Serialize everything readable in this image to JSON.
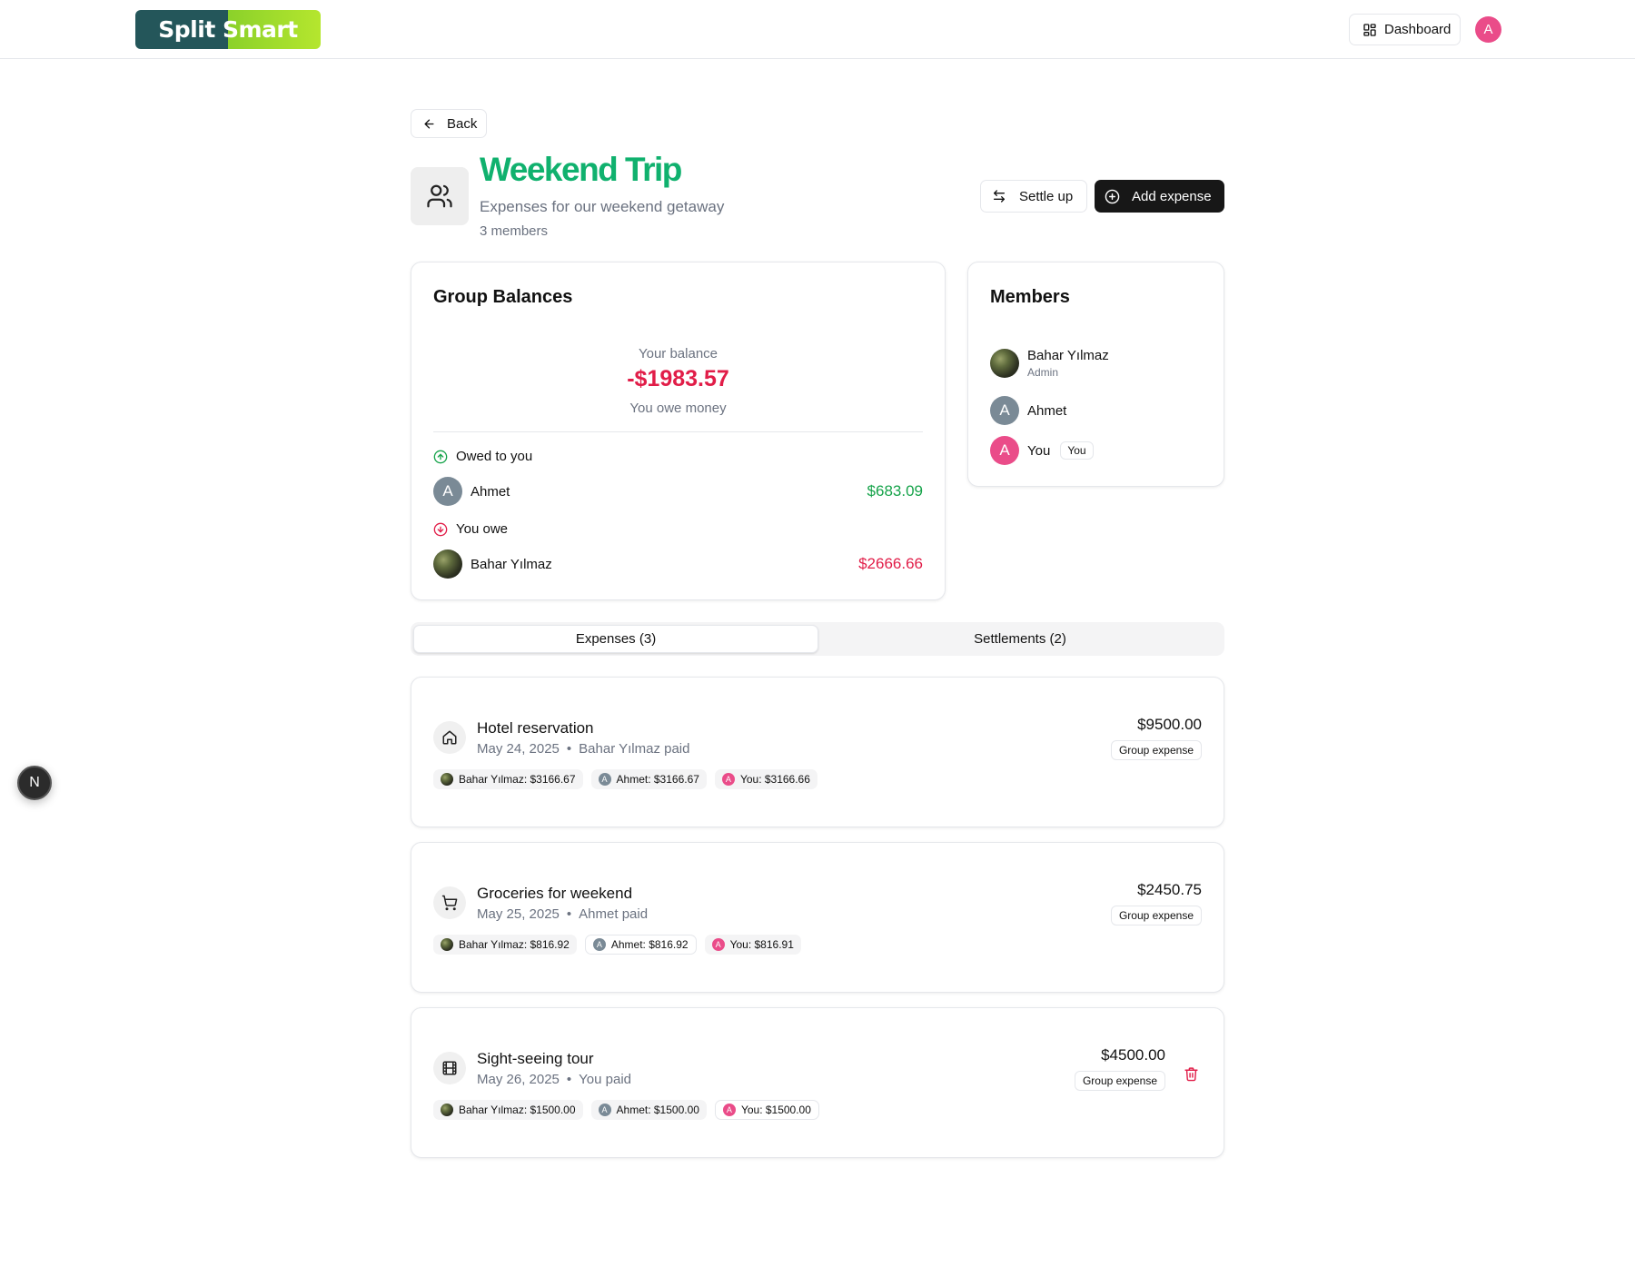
{
  "header": {
    "logo_part1": "Split",
    "logo_part2": "Smart",
    "dashboard_label": "Dashboard",
    "avatar_initial": "A"
  },
  "nav": {
    "back_label": "Back"
  },
  "group": {
    "title": "Weekend Trip",
    "description": "Expenses for our weekend getaway",
    "members_count": "3 members",
    "settle_label": "Settle up",
    "add_expense_label": "Add expense"
  },
  "balances": {
    "title": "Group Balances",
    "your_balance_label": "Your balance",
    "your_balance_value": "-$1983.57",
    "your_balance_note": "You owe money",
    "owed_to_you_label": "Owed to you",
    "owed_to_you": [
      {
        "name": "Ahmet",
        "initial": "A",
        "amount": "$683.09"
      }
    ],
    "you_owe_label": "You owe",
    "you_owe": [
      {
        "name": "Bahar Yılmaz",
        "amount": "$2666.66"
      }
    ]
  },
  "members": {
    "title": "Members",
    "list": [
      {
        "name": "Bahar Yılmaz",
        "role": "Admin"
      },
      {
        "name": "Ahmet",
        "initial": "A"
      },
      {
        "name": "You",
        "initial": "A",
        "tag": "You"
      }
    ]
  },
  "tabs": [
    {
      "label": "Expenses (3)",
      "active": true
    },
    {
      "label": "Settlements (2)",
      "active": false
    }
  ],
  "expenses": [
    {
      "icon": "home-icon",
      "title": "Hotel reservation",
      "date": "May 24, 2025",
      "paid_by": "Bahar Yılmaz paid",
      "amount": "$9500.00",
      "badge": "Group expense",
      "splits": [
        {
          "label": "Bahar Yılmaz: $3166.67"
        },
        {
          "label": "Ahmet: $3166.67",
          "initial": "A"
        },
        {
          "label": "You: $3166.66",
          "initial": "A"
        }
      ]
    },
    {
      "icon": "shopping-cart-icon",
      "title": "Groceries for weekend",
      "date": "May 25, 2025",
      "paid_by": "Ahmet paid",
      "amount": "$2450.75",
      "badge": "Group expense",
      "splits": [
        {
          "label": "Bahar Yılmaz: $816.92"
        },
        {
          "label": "Ahmet: $816.92",
          "initial": "A"
        },
        {
          "label": "You: $816.91",
          "initial": "A"
        }
      ]
    },
    {
      "icon": "film-icon",
      "title": "Sight-seeing tour",
      "date": "May 26, 2025",
      "paid_by": "You paid",
      "amount": "$4500.00",
      "badge": "Group expense",
      "splits": [
        {
          "label": "Bahar Yılmaz: $1500.00"
        },
        {
          "label": "Ahmet: $1500.00",
          "initial": "A"
        },
        {
          "label": "You: $1500.00",
          "initial": "A"
        }
      ]
    }
  ],
  "dev_badge": "N",
  "colors": {
    "brand_green": "#10b16e",
    "positive": "#16a34a",
    "negative": "#e11d48",
    "avatar_pink": "#ea4c89",
    "avatar_gray": "#7a8a96"
  }
}
